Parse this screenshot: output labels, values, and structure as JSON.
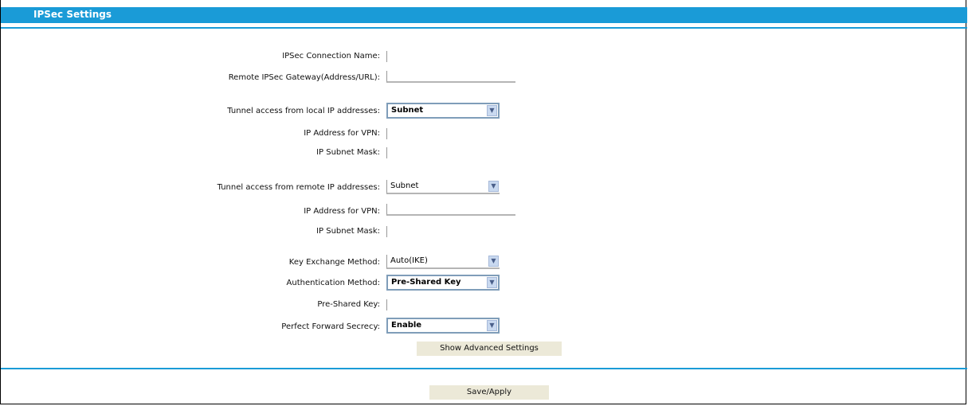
{
  "header": {
    "title": "IPSec Settings"
  },
  "form": {
    "ipsec_connection_name": {
      "label": "IPSec Connection Name:",
      "value": ""
    },
    "remote_gateway": {
      "label": "Remote IPSec Gateway(Address/URL):",
      "value": ""
    },
    "local_access": {
      "label": "Tunnel access from local IP addresses:",
      "value": "Subnet"
    },
    "local_ip": {
      "label": "IP Address for VPN:",
      "value": ""
    },
    "local_mask": {
      "label": "IP Subnet Mask:",
      "value": ""
    },
    "remote_access": {
      "label": "Tunnel access from remote IP addresses:",
      "value": "Subnet"
    },
    "remote_ip": {
      "label": "IP Address for VPN:",
      "value": ""
    },
    "remote_mask": {
      "label": "IP Subnet Mask:",
      "value": ""
    },
    "key_exchange": {
      "label": "Key Exchange Method:",
      "value": "Auto(IKE)"
    },
    "auth_method": {
      "label": "Authentication Method:",
      "value": "Pre-Shared Key"
    },
    "pre_shared_key": {
      "label": "Pre-Shared Key:",
      "value": ""
    },
    "pfs": {
      "label": "Perfect Forward Secrecy:",
      "value": "Enable"
    }
  },
  "buttons": {
    "advanced": "Show Advanced Settings",
    "save": "Save/Apply"
  },
  "colors": {
    "accent": "#1a9bd7",
    "button_bg": "#ece9d8"
  }
}
